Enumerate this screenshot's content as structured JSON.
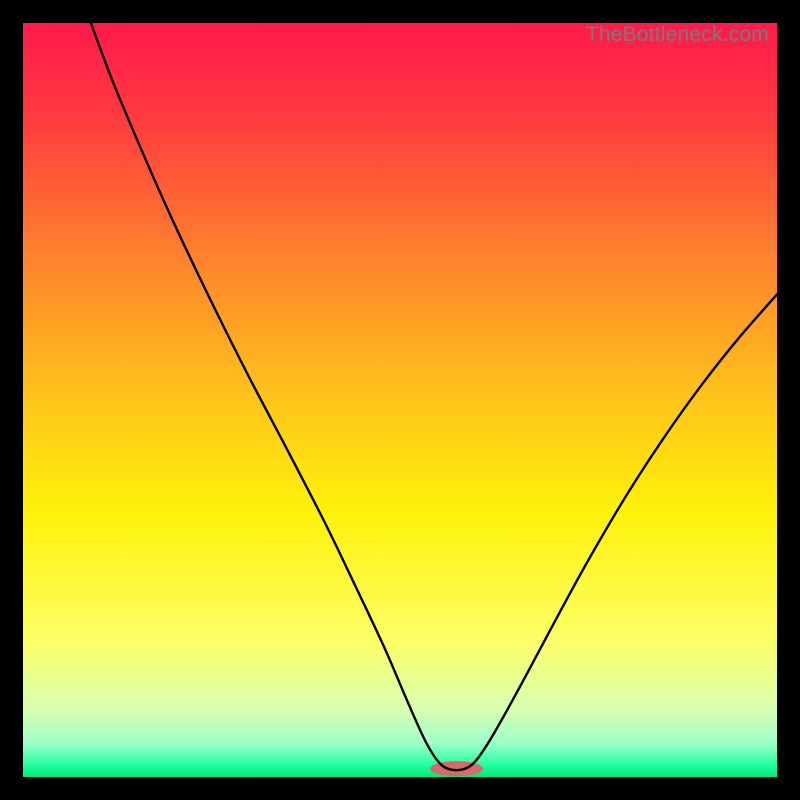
{
  "watermark": "TheBottleneck.com",
  "chart_data": {
    "type": "line",
    "title": "",
    "xlabel": "",
    "ylabel": "",
    "xlim": [
      0,
      100
    ],
    "ylim": [
      0,
      100
    ],
    "background_gradient": {
      "stops": [
        {
          "pct": 0.0,
          "color": "#ff1a4b"
        },
        {
          "pct": 0.12,
          "color": "#ff3940"
        },
        {
          "pct": 0.3,
          "color": "#ff7e2e"
        },
        {
          "pct": 0.5,
          "color": "#ffc51b"
        },
        {
          "pct": 0.65,
          "color": "#fff20a"
        },
        {
          "pct": 0.82,
          "color": "#fcff67"
        },
        {
          "pct": 0.91,
          "color": "#d8ffb0"
        },
        {
          "pct": 0.955,
          "color": "#9dffca"
        },
        {
          "pct": 0.985,
          "color": "#1fff9e"
        },
        {
          "pct": 1.0,
          "color": "#00e876"
        }
      ]
    },
    "marker": {
      "cx": 57.5,
      "cy": 1.1,
      "rx": 3.5,
      "ry": 1.0,
      "color": "#d46a6a"
    },
    "series": [
      {
        "name": "curve",
        "color": "#000000",
        "points": [
          {
            "x": 9.0,
            "y": 100.0
          },
          {
            "x": 12.0,
            "y": 92.0
          },
          {
            "x": 16.0,
            "y": 82.5
          },
          {
            "x": 20.0,
            "y": 73.5
          },
          {
            "x": 25.0,
            "y": 63.0
          },
          {
            "x": 30.0,
            "y": 53.0
          },
          {
            "x": 35.0,
            "y": 43.5
          },
          {
            "x": 40.0,
            "y": 33.8
          },
          {
            "x": 44.0,
            "y": 25.5
          },
          {
            "x": 48.0,
            "y": 17.0
          },
          {
            "x": 51.0,
            "y": 10.0
          },
          {
            "x": 53.5,
            "y": 4.5
          },
          {
            "x": 55.5,
            "y": 1.6
          },
          {
            "x": 57.5,
            "y": 0.9
          },
          {
            "x": 59.5,
            "y": 1.6
          },
          {
            "x": 61.5,
            "y": 4.2
          },
          {
            "x": 64.0,
            "y": 8.5
          },
          {
            "x": 67.0,
            "y": 14.0
          },
          {
            "x": 71.0,
            "y": 21.5
          },
          {
            "x": 75.0,
            "y": 28.8
          },
          {
            "x": 80.0,
            "y": 37.3
          },
          {
            "x": 85.0,
            "y": 45.0
          },
          {
            "x": 90.0,
            "y": 52.0
          },
          {
            "x": 95.0,
            "y": 58.3
          },
          {
            "x": 100.0,
            "y": 64.0
          }
        ]
      }
    ]
  }
}
